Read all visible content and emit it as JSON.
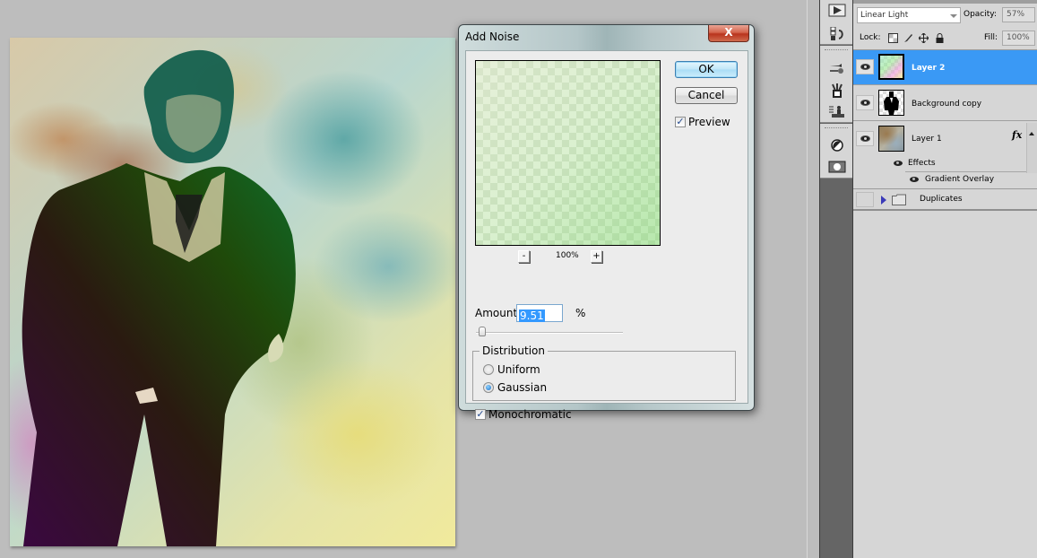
{
  "dialog": {
    "title": "Add Noise",
    "close_label": "X",
    "ok_label": "OK",
    "cancel_label": "Cancel",
    "preview_label": "Preview",
    "preview_checked": true,
    "zoom_out_label": "-",
    "zoom_in_label": "+",
    "zoom_level": "100%",
    "amount_label": "Amount:",
    "amount_value": "9.51",
    "amount_unit": "%",
    "amount_slider_percent": 2,
    "distribution_label": "Distribution",
    "distribution_options": [
      {
        "label": "Uniform",
        "selected": false
      },
      {
        "label": "Gaussian",
        "selected": true
      }
    ],
    "monochromatic_label": "Monochromatic",
    "monochromatic_checked": true
  },
  "layers_panel": {
    "blend_mode": "Linear Light",
    "opacity_label": "Opacity:",
    "opacity_value": "57%",
    "lock_label": "Lock:",
    "fill_label": "Fill:",
    "fill_value": "100%",
    "layers": [
      {
        "name": "Layer 2",
        "visible": true,
        "selected": true
      },
      {
        "name": "Background copy",
        "visible": true,
        "selected": false
      },
      {
        "name": "Layer 1",
        "visible": true,
        "selected": false,
        "has_fx": true,
        "fx_label": "fx"
      }
    ],
    "effects_label": "Effects",
    "effect_items": [
      "Gradient Overlay"
    ],
    "group_name": "Duplicates"
  },
  "dock": {
    "icons": [
      "actions-play-icon",
      "history-icon",
      "brushes-icon",
      "tool-presets-icon",
      "clone-source-icon",
      "adjustments-icon",
      "masks-icon"
    ]
  },
  "colors": {
    "selection_blue": "#3a99f5",
    "text_highlight": "#3399ff",
    "close_red": "#c7432a"
  }
}
